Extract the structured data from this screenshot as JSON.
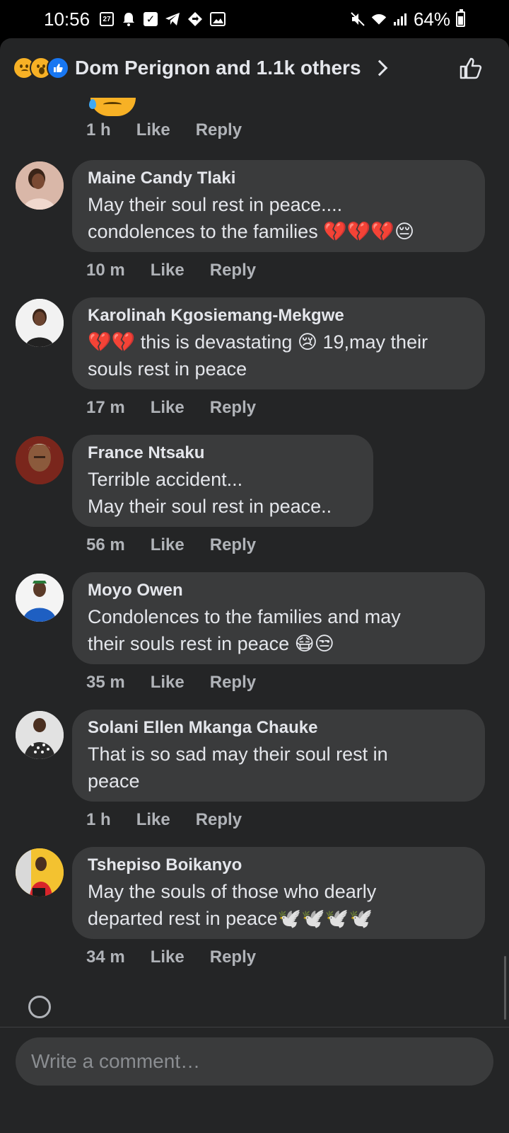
{
  "status_bar": {
    "time": "10:56",
    "calendar_day": "27",
    "battery": "64%",
    "battery_level": 0.64
  },
  "reactions": {
    "summary": "Dom Perignon and 1.1k others",
    "icons": [
      "sad-reaction",
      "wow-reaction",
      "like-reaction"
    ]
  },
  "previous_comment": {
    "time": "1 h",
    "like": "Like",
    "reply": "Reply"
  },
  "comments": [
    {
      "author": "Maine Candy Tlaki",
      "text": "May their soul rest in peace....\ncondolences to the families 💔💔💔😔",
      "time": "10 m",
      "like": "Like",
      "reply": "Reply"
    },
    {
      "author": "Karolinah Kgosiemang-Mekgwe",
      "text": "💔💔 this is devastating 😢 19,may their\nsouls rest in peace",
      "time": "17 m",
      "like": "Like",
      "reply": "Reply"
    },
    {
      "author": "France Ntsaku",
      "text": "Terrible accident...\nMay their soul rest in peace..",
      "time": "56 m",
      "like": "Like",
      "reply": "Reply"
    },
    {
      "author": "Moyo Owen",
      "text": "Condolences to the families and may\ntheir souls rest in peace 😷😒",
      "time": "35 m",
      "like": "Like",
      "reply": "Reply"
    },
    {
      "author": "Solani Ellen Mkanga Chauke",
      "text": "That is so sad may their soul rest in\npeace",
      "time": "1 h",
      "like": "Like",
      "reply": "Reply"
    },
    {
      "author": "Tshepiso Boikanyo",
      "text": "May the souls of those who dearly\ndeparted rest in peace🕊️🕊️🕊️🕊️",
      "time": "34 m",
      "like": "Like",
      "reply": "Reply"
    }
  ],
  "composer": {
    "placeholder": "Write a comment…"
  },
  "colors": {
    "sheet_bg": "#242526",
    "bubble_bg": "#3a3b3c",
    "text": "#e4e6eb",
    "muted": "#b0b3b8",
    "like_blue": "#1877f2",
    "reaction_yellow": "#f7b125"
  }
}
